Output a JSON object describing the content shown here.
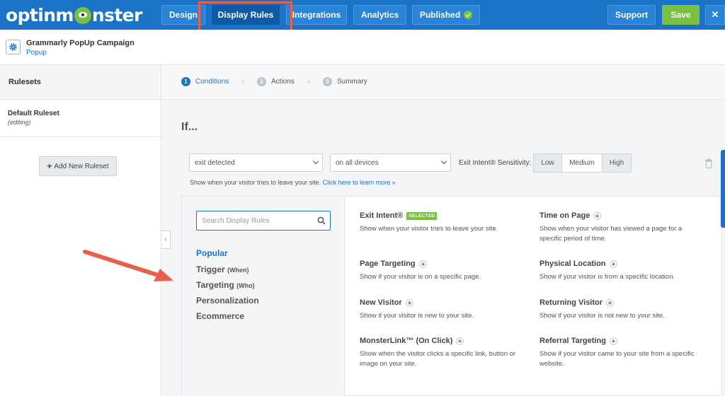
{
  "brand": {
    "logo_before": "optinm",
    "logo_after": "nster"
  },
  "nav": {
    "tabs": [
      {
        "label": "Design"
      },
      {
        "label": "Display Rules"
      },
      {
        "label": "Integrations"
      },
      {
        "label": "Analytics"
      },
      {
        "label": "Published"
      }
    ],
    "active_tab": "Display Rules",
    "support_label": "Support",
    "save_label": "Save",
    "close_label": "✕"
  },
  "campaign": {
    "title": "Grammarly PopUp Campaign",
    "type": "Popup"
  },
  "sidebar": {
    "heading": "Rulesets",
    "rulesets": [
      {
        "name": "Default Ruleset",
        "status": "(editing)"
      }
    ],
    "add_button": "Add New Ruleset"
  },
  "steps": [
    {
      "num": "1",
      "label": "Conditions",
      "active": true
    },
    {
      "num": "2",
      "label": "Actions",
      "active": false
    },
    {
      "num": "3",
      "label": "Summary",
      "active": false
    }
  ],
  "main": {
    "if_heading": "If..."
  },
  "condition": {
    "trigger_select": "exit detected",
    "device_select": "on all devices",
    "sensitivity_label": "Exit Intent® Sensitivity:",
    "sensitivity_options": [
      "Low",
      "Medium",
      "High"
    ],
    "sensitivity_selected": "Medium",
    "help_text": "Show when your visitor tries to leave your site.",
    "help_link": "Click here to learn more »"
  },
  "rule_picker": {
    "search_placeholder": "Search Display Rules",
    "categories": [
      {
        "label": "Popular",
        "suffix": ""
      },
      {
        "label": "Trigger",
        "suffix": "(When)"
      },
      {
        "label": "Targeting",
        "suffix": "(Who)"
      },
      {
        "label": "Personalization",
        "suffix": ""
      },
      {
        "label": "Ecommerce",
        "suffix": ""
      }
    ],
    "active_category": "Popular",
    "selected_badge": "SELECTED",
    "rules": [
      {
        "title": "Exit Intent®",
        "desc": "Show when your visitor tries to leave your site.",
        "selected": true
      },
      {
        "title": "Time on Page",
        "desc": "Show when your visitor has viewed a page for a specific period of time.",
        "selected": false
      },
      {
        "title": "Page Targeting",
        "desc": "Show if your visitor is on a specific page.",
        "selected": false
      },
      {
        "title": "Physical Location",
        "desc": "Show if your visitor is from a specific location.",
        "selected": false
      },
      {
        "title": "New Visitor",
        "desc": "Show if your visitor is new to your site.",
        "selected": false
      },
      {
        "title": "Returning Visitor",
        "desc": "Show if your visitor is not new to your site.",
        "selected": false
      },
      {
        "title": "MonsterLink™ (On Click)",
        "desc": "Show when the visitor clicks a specific link, button or image on your site.",
        "selected": false
      },
      {
        "title": "Referral Targeting",
        "desc": "Show if your visitor came to your site from a specific website.",
        "selected": false
      }
    ]
  },
  "colors": {
    "topbar": "#1b73c7",
    "accent": "#1b73c7",
    "save_green": "#7ac143",
    "annotation_red": "#e8604c"
  }
}
